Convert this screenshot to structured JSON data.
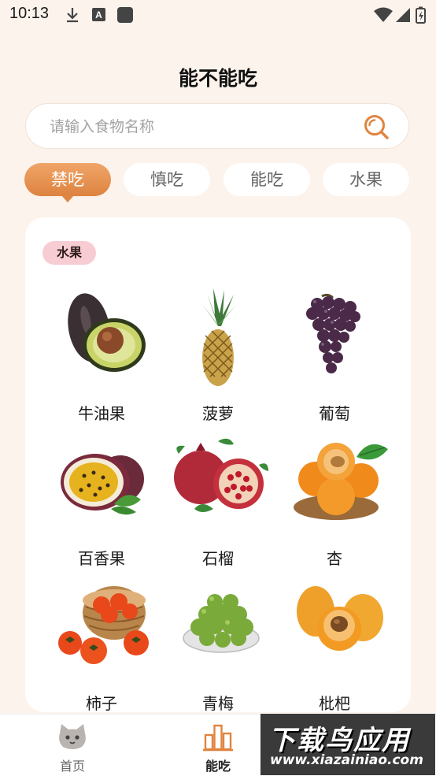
{
  "status_bar": {
    "time": "10:13"
  },
  "header": {
    "title": "能不能吃"
  },
  "search": {
    "placeholder": "请输入食物名称",
    "value": ""
  },
  "tabs": [
    {
      "label": "禁吃",
      "active": true
    },
    {
      "label": "慎吃",
      "active": false
    },
    {
      "label": "能吃",
      "active": false
    },
    {
      "label": "水果",
      "active": false
    }
  ],
  "card": {
    "category_label": "水果",
    "items": [
      {
        "name": "牛油果",
        "icon": "avocado"
      },
      {
        "name": "菠萝",
        "icon": "pineapple"
      },
      {
        "name": "葡萄",
        "icon": "grape"
      },
      {
        "name": "百香果",
        "icon": "passion-fruit"
      },
      {
        "name": "石榴",
        "icon": "pomegranate"
      },
      {
        "name": "杏",
        "icon": "apricot"
      },
      {
        "name": "柿子",
        "icon": "persimmon"
      },
      {
        "name": "青梅",
        "icon": "green-plum"
      },
      {
        "name": "枇杷",
        "icon": "loquat"
      }
    ]
  },
  "bottom_nav": [
    {
      "label": "首页",
      "icon": "cat-face-icon",
      "active": false
    },
    {
      "label": "能吃",
      "icon": "bar-chart-icon",
      "active": true
    }
  ],
  "watermark": {
    "line1": "下载鸟应用",
    "line2": "www.xiazainiao.com"
  },
  "colors": {
    "background": "#fcf3ec",
    "accent": "#e38a47",
    "badge_pink": "#f8ccd3"
  }
}
